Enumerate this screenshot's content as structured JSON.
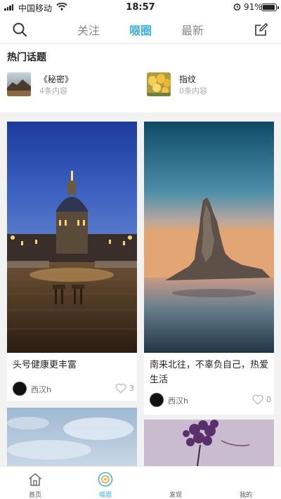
{
  "status_bar": {
    "carrier": "中国移动",
    "time": "18:57",
    "battery": "91%"
  },
  "header": {
    "tabs": [
      "关注",
      "啜圈",
      "最新"
    ],
    "active_tab": 1
  },
  "hot_topics": {
    "title": "热门话题",
    "items": [
      {
        "name": "《秘密》",
        "count": "4条内容"
      },
      {
        "name": "指纹",
        "count": "0条内容"
      }
    ]
  },
  "feed": [
    {
      "caption": "头号健康更丰富",
      "user": "西汉h",
      "likes": "3"
    },
    {
      "caption": "南来北往，不辜负自己，热爱生活",
      "user": "西汉h",
      "likes": "0"
    }
  ],
  "bottom_nav": {
    "items": [
      "首页",
      "啜圈",
      "发现",
      "我的"
    ],
    "active": 1
  },
  "colors": {
    "accent": "#3cb3d6"
  }
}
